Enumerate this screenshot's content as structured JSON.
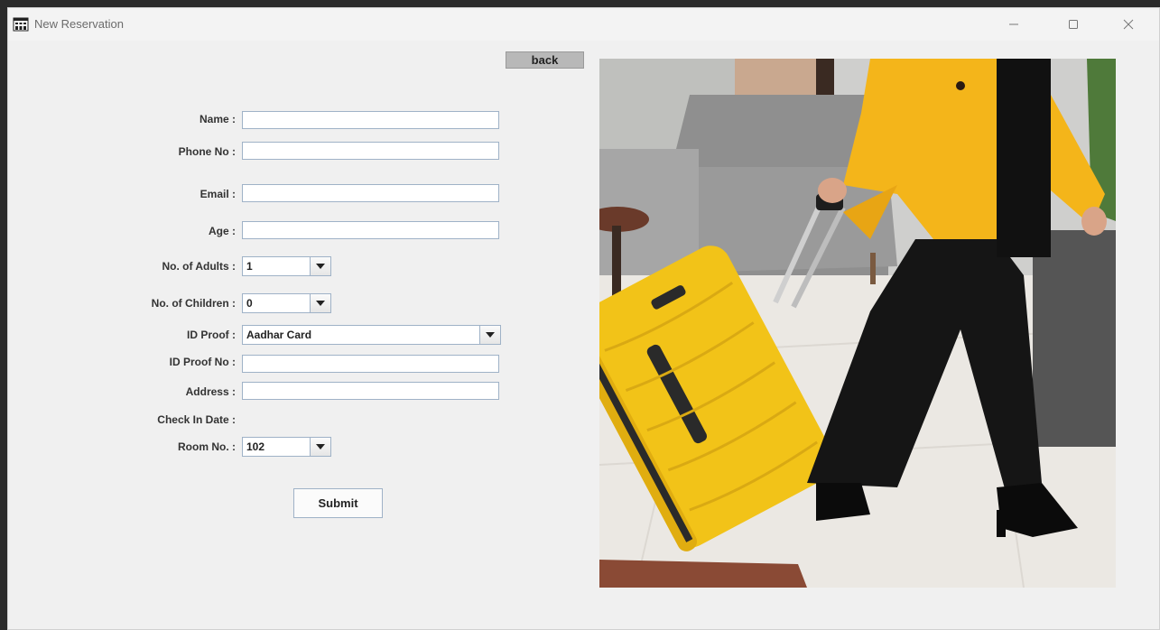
{
  "window": {
    "title": "New Reservation"
  },
  "toolbar": {
    "back_label": "back"
  },
  "form": {
    "name_label": "Name :",
    "name_value": "",
    "phone_label": "Phone No :",
    "phone_value": "",
    "email_label": "Email :",
    "email_value": "",
    "age_label": "Age :",
    "age_value": "",
    "adults_label": "No. of Adults :",
    "adults_value": "1",
    "children_label": "No. of Children :",
    "children_value": "0",
    "idproof_label": "ID Proof :",
    "idproof_value": "Aadhar Card",
    "idproofno_label": "ID Proof No :",
    "idproofno_value": "",
    "address_label": "Address :",
    "address_value": "",
    "checkin_label": "Check In Date :",
    "room_label": "Room No. :",
    "room_value": "102",
    "submit_label": "Submit"
  },
  "colors": {
    "window_bg": "#f0f0f0",
    "field_border": "#9fb2c7",
    "suitcase_yellow": "#f2c318",
    "blazer_yellow": "#f4b51a"
  },
  "icons": {
    "app": "hotel-icon",
    "minimize": "minimize-icon",
    "maximize": "maximize-icon",
    "close": "close-icon",
    "dropdown": "dropdown-arrow-icon"
  }
}
